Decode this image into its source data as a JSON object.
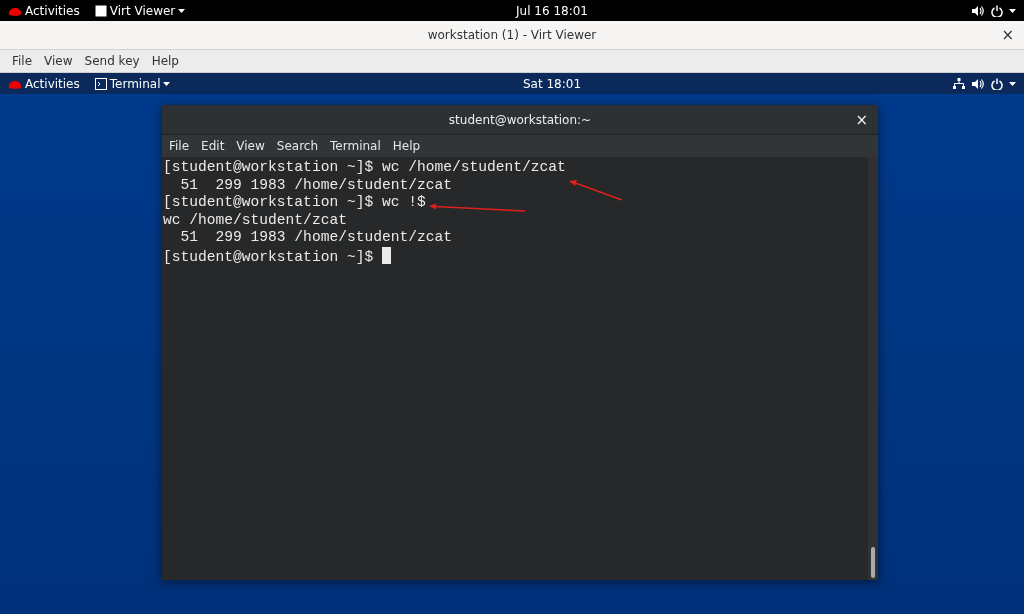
{
  "host_top_bar": {
    "activities": "Activities",
    "app_menu": "Virt Viewer",
    "clock": "Jul 16  18:01"
  },
  "viewer_window": {
    "title": "workstation (1) - Virt Viewer",
    "close": "×",
    "menu": [
      "File",
      "View",
      "Send key",
      "Help"
    ]
  },
  "guest_top_bar": {
    "activities": "Activities",
    "app_menu": "Terminal",
    "clock": "Sat 18:01"
  },
  "terminal": {
    "title": "student@workstation:~",
    "close": "×",
    "menu": [
      "File",
      "Edit",
      "View",
      "Search",
      "Terminal",
      "Help"
    ],
    "lines": [
      "[student@workstation ~]$ wc /home/student/zcat",
      "  51  299 1983 /home/student/zcat",
      "[student@workstation ~]$ wc !$",
      "wc /home/student/zcat",
      "  51  299 1983 /home/student/zcat",
      "[student@workstation ~]$ "
    ],
    "cursor_visible": true
  }
}
